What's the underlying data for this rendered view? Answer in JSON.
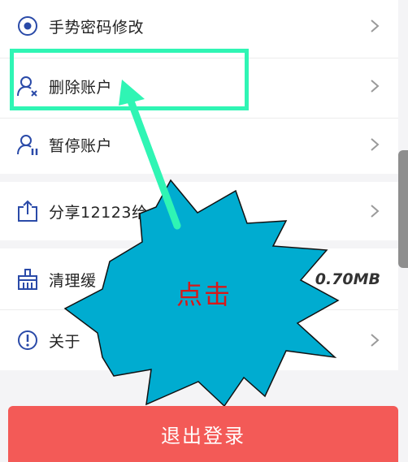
{
  "settings": {
    "group1": [
      {
        "icon": "target-circle-icon",
        "label": "手势密码修改"
      },
      {
        "icon": "delete-user-icon",
        "label": "删除账户"
      },
      {
        "icon": "pause-user-icon",
        "label": "暂停账户"
      }
    ],
    "share": {
      "icon": "share-icon",
      "label": "分享12123给"
    },
    "clear_cache": {
      "icon": "broom-icon",
      "label": "清理缓",
      "value": "0.70MB"
    },
    "about": {
      "icon": "info-icon",
      "label": "关于"
    }
  },
  "annotation": {
    "label": "点击",
    "color": "#d81818",
    "box_color": "#2ff5b4",
    "burst_color": "#00acd0"
  },
  "logout": {
    "label": "退出登录",
    "color": "#f35a57"
  }
}
